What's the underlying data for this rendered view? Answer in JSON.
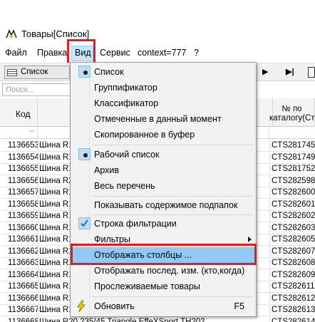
{
  "window": {
    "title": "Товары[Список]"
  },
  "menubar": {
    "items": [
      {
        "label": "Файл"
      },
      {
        "label": "Правка"
      },
      {
        "label": "Вид"
      },
      {
        "label": "Сервис"
      },
      {
        "label": "context=777"
      },
      {
        "label": "?"
      }
    ]
  },
  "toolbar": {
    "list_combo_label": "Список",
    "nav_next": "▶",
    "nav_last": "▶|"
  },
  "search": {
    "placeholder": "Поиск..."
  },
  "table": {
    "headers": {
      "kod": "Код",
      "catalog_line1": "№ по",
      "catalog_line2": "каталогу(Ст"
    },
    "rows": [
      {
        "kod": "1136653",
        "name": "Шина R1",
        "cat": "CTS281745"
      },
      {
        "kod": "1136654",
        "name": "Шина R1",
        "cat": "CTS281749"
      },
      {
        "kod": "1136655",
        "name": "Шина R1",
        "cat": "CTS281752"
      },
      {
        "kod": "1136656",
        "name": "Шина R2",
        "cat": "CTS282598"
      },
      {
        "kod": "1136657",
        "name": "Шина R1",
        "cat": "CTS282600"
      },
      {
        "kod": "1136658",
        "name": "Шина R1",
        "cat": "CTS282601"
      },
      {
        "kod": "1136659",
        "name": "Шина R1",
        "cat": "CTS282602"
      },
      {
        "kod": "1136660",
        "name": "Шина R1",
        "cat": "CTS282603"
      },
      {
        "kod": "1136661",
        "name": "Шина R1",
        "cat": "CTS282605"
      },
      {
        "kod": "1136662",
        "name": "Шина R1",
        "cat": "CTS282607"
      },
      {
        "kod": "1136663",
        "name": "Шина R1",
        "cat": "CTS282608"
      },
      {
        "kod": "1136664",
        "name": "Шина R1",
        "cat": "CTS282609"
      },
      {
        "kod": "1136665",
        "name": "Шина R1",
        "cat": "CTS282611"
      },
      {
        "kod": "1136666",
        "name": "Шина R1",
        "cat": "CTS282612"
      },
      {
        "kod": "1136667",
        "name": "Шина R1",
        "cat": "CTS282613"
      },
      {
        "kod": "1136668",
        "name": "Шина R20 235/45 Triangle EffeXSport TH202",
        "cat": "CTS282614"
      }
    ]
  },
  "dropdown": {
    "items": [
      {
        "label": "Список",
        "mark": "dot"
      },
      {
        "label": "Группификатор"
      },
      {
        "label": "Классификатор"
      },
      {
        "label": "Отмеченные в данный момент"
      },
      {
        "label": "Скопированное в буфер"
      },
      {
        "label": "Рабочий список",
        "mark": "dot"
      },
      {
        "label": "Архив"
      },
      {
        "label": "Весь перечень"
      },
      {
        "label": "Показывать содержимое подпапок"
      },
      {
        "label": "Строка фильтрации",
        "mark": "check"
      },
      {
        "label": "Фильтры",
        "submenu": true
      },
      {
        "label": "Отображать столбцы ...",
        "highlighted": true
      },
      {
        "label": "Отображать послед. изм. (кто,когда)"
      },
      {
        "label": "Прослеживаемые товары"
      },
      {
        "label": "Обновить",
        "shortcut": "F5",
        "icon": "lightning-icon"
      }
    ]
  },
  "colors": {
    "highlight": "#91c9f7",
    "annotation_red": "#e51c1c",
    "check_blue": "#1e6fc2"
  }
}
